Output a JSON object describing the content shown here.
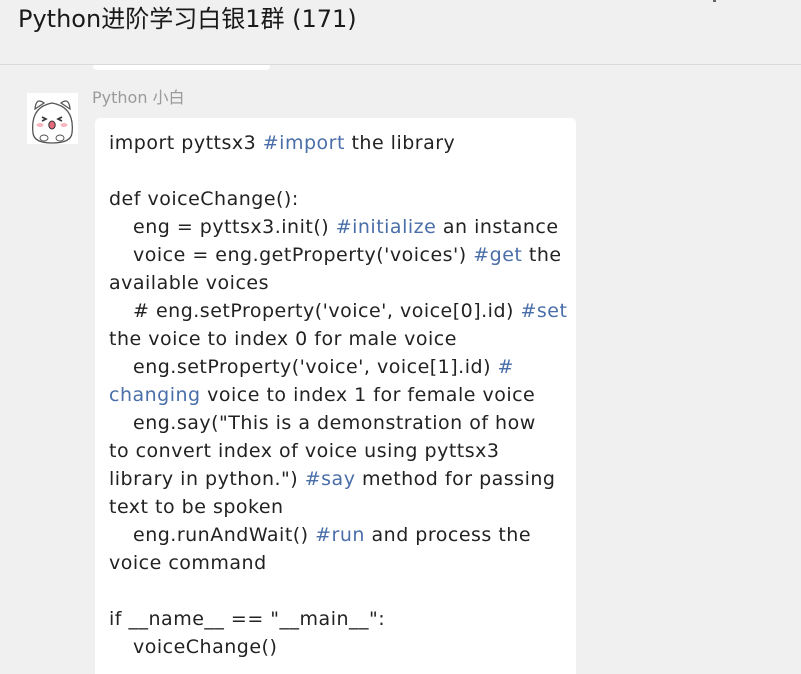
{
  "header": {
    "title": "Python进阶学习白银1群 (171)"
  },
  "message": {
    "sender": "Python 小白",
    "lines": [
      [
        "import pyttsx3 ",
        "#import",
        " the library"
      ],
      null,
      [
        "def voiceChange():"
      ],
      [
        "eng = pyttsx3.init() ",
        "#initialize",
        " an instance"
      ],
      [
        "voice = eng.getProperty('voices') ",
        "#get",
        " the"
      ],
      [
        "available voices"
      ],
      [
        "# eng.setProperty('voice', voice[0].id) ",
        "#set",
        ""
      ],
      [
        "the voice to index 0 for male voice"
      ],
      [
        "eng.setProperty('voice', voice[1].id) ",
        "#",
        ""
      ],
      [
        "",
        "changing",
        " voice to index 1 for female voice"
      ],
      [
        "eng.say(\"This is a demonstration of how"
      ],
      [
        "to convert index of voice using pyttsx3"
      ],
      [
        "library in python.\") ",
        "#say",
        " method for passing"
      ],
      [
        "text to be spoken"
      ],
      [
        "eng.runAndWait() ",
        "#run",
        " and process the"
      ],
      [
        "voice command"
      ],
      null,
      [
        "if __name__ == \"__main__\":"
      ],
      [
        "voiceChange()"
      ]
    ]
  },
  "colors": {
    "hashtag": "#4a6ea8",
    "background": "#f0f0f0",
    "bubble": "#ffffff"
  },
  "avatar_icon": "cartoon-cat-avatar"
}
